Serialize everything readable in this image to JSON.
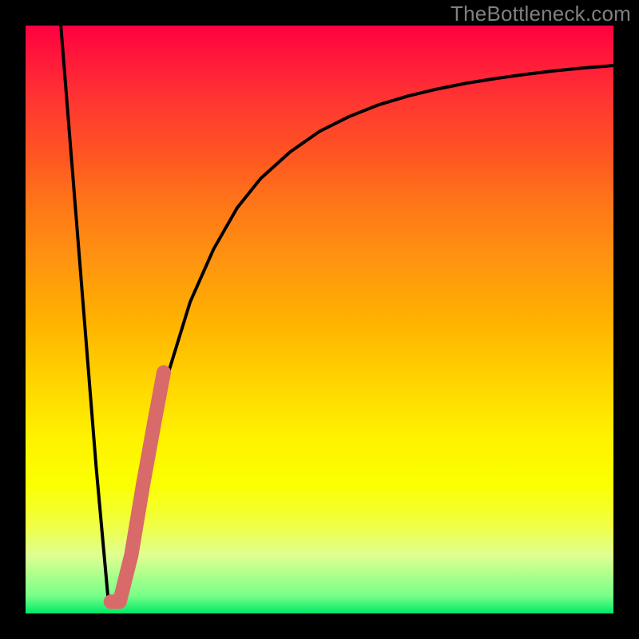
{
  "watermark": "TheBottleneck.com",
  "chart_data": {
    "type": "line",
    "title": "",
    "xlabel": "",
    "ylabel": "",
    "xlim": [
      0,
      100
    ],
    "ylim": [
      0,
      100
    ],
    "series": [
      {
        "name": "bottleneck-curve",
        "x": [
          6,
          8,
          10,
          12,
          14,
          16,
          18,
          20,
          24,
          28,
          32,
          36,
          40,
          45,
          50,
          55,
          60,
          65,
          70,
          75,
          80,
          85,
          90,
          95,
          100
        ],
        "values": [
          100,
          75,
          50,
          25,
          3,
          2,
          10,
          22,
          40,
          53,
          62,
          69,
          74,
          78.5,
          82,
          84.5,
          86.5,
          88,
          89.2,
          90.2,
          91,
          91.7,
          92.3,
          92.8,
          93.2
        ]
      }
    ],
    "highlight_segment": {
      "name": "highlight",
      "x": [
        14.5,
        16,
        18,
        20,
        22,
        23.5
      ],
      "values": [
        2,
        2,
        10,
        22,
        33,
        41
      ]
    },
    "colors": {
      "curve": "#000000",
      "highlight": "#d86a6a"
    }
  }
}
